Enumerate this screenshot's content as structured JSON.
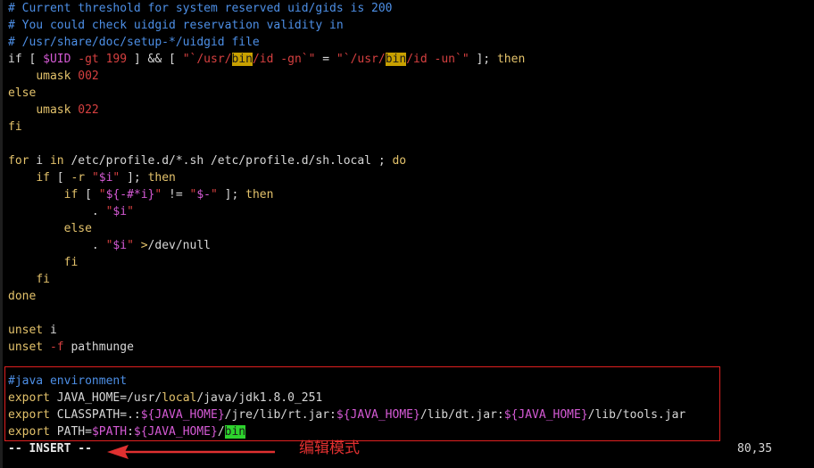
{
  "editor": {
    "lines": [
      [
        {
          "t": "# Current threshold for system reserved uid/gids is 200",
          "c": "cmt"
        }
      ],
      [
        {
          "t": "# You could check uidgid reservation validity in",
          "c": "cmt"
        }
      ],
      [
        {
          "t": "# /usr/share/doc/setup-*/uidgid file",
          "c": "cmt"
        }
      ],
      [
        {
          "t": "if",
          "c": "kw"
        },
        {
          "t": " [ "
        },
        {
          "t": "$UID",
          "c": "var"
        },
        {
          "t": " -gt ",
          "c": "str"
        },
        {
          "t": "199",
          "c": "str"
        },
        {
          "t": " ] && [ "
        },
        {
          "t": "\"`/usr/",
          "c": "str"
        },
        {
          "t": "bin",
          "c": "hl"
        },
        {
          "t": "/id -gn`\"",
          "c": "str"
        },
        {
          "t": " = "
        },
        {
          "t": "\"`/usr/",
          "c": "str"
        },
        {
          "t": "bin",
          "c": "hl"
        },
        {
          "t": "/id -un`\"",
          "c": "str"
        },
        {
          "t": " ]; "
        },
        {
          "t": "then",
          "c": "stmt"
        }
      ],
      [
        {
          "t": "    "
        },
        {
          "t": "umask",
          "c": "stmt"
        },
        {
          "t": " "
        },
        {
          "t": "002",
          "c": "str"
        }
      ],
      [
        {
          "t": "else",
          "c": "stmt"
        }
      ],
      [
        {
          "t": "    "
        },
        {
          "t": "umask",
          "c": "stmt"
        },
        {
          "t": " "
        },
        {
          "t": "022",
          "c": "str"
        }
      ],
      [
        {
          "t": "fi",
          "c": "stmt"
        }
      ],
      [
        {
          "t": ""
        }
      ],
      [
        {
          "t": "for",
          "c": "stmt"
        },
        {
          "t": " i "
        },
        {
          "t": "in",
          "c": "stmt"
        },
        {
          "t": " /etc/profile.d/*.sh /etc/profile.d/sh.local ; "
        },
        {
          "t": "do",
          "c": "stmt"
        }
      ],
      [
        {
          "t": "    "
        },
        {
          "t": "if",
          "c": "stmt"
        },
        {
          "t": " [ "
        },
        {
          "t": "-r",
          "c": "stmt"
        },
        {
          "t": " "
        },
        {
          "t": "\"",
          "c": "str"
        },
        {
          "t": "$i",
          "c": "var"
        },
        {
          "t": "\"",
          "c": "str"
        },
        {
          "t": " ]; "
        },
        {
          "t": "then",
          "c": "stmt"
        }
      ],
      [
        {
          "t": "        "
        },
        {
          "t": "if",
          "c": "stmt"
        },
        {
          "t": " [ "
        },
        {
          "t": "\"",
          "c": "str"
        },
        {
          "t": "${-#*i}",
          "c": "var"
        },
        {
          "t": "\"",
          "c": "str"
        },
        {
          "t": " != "
        },
        {
          "t": "\"",
          "c": "str"
        },
        {
          "t": "$-",
          "c": "var"
        },
        {
          "t": "\"",
          "c": "str"
        },
        {
          "t": " ]; "
        },
        {
          "t": "then",
          "c": "stmt"
        }
      ],
      [
        {
          "t": "            . "
        },
        {
          "t": "\"",
          "c": "str"
        },
        {
          "t": "$i",
          "c": "var"
        },
        {
          "t": "\"",
          "c": "str"
        }
      ],
      [
        {
          "t": "        "
        },
        {
          "t": "else",
          "c": "stmt"
        }
      ],
      [
        {
          "t": "            . "
        },
        {
          "t": "\"",
          "c": "str"
        },
        {
          "t": "$i",
          "c": "var"
        },
        {
          "t": "\"",
          "c": "str"
        },
        {
          "t": " "
        },
        {
          "t": ">",
          "c": "stmt"
        },
        {
          "t": "/dev/null"
        }
      ],
      [
        {
          "t": "        "
        },
        {
          "t": "fi",
          "c": "stmt"
        }
      ],
      [
        {
          "t": "    "
        },
        {
          "t": "fi",
          "c": "stmt"
        }
      ],
      [
        {
          "t": "done",
          "c": "stmt"
        }
      ],
      [
        {
          "t": ""
        }
      ],
      [
        {
          "t": "unset",
          "c": "stmt"
        },
        {
          "t": " "
        },
        {
          "t": "i",
          "c": "kw"
        }
      ],
      [
        {
          "t": "unset",
          "c": "stmt"
        },
        {
          "t": " "
        },
        {
          "t": "-f",
          "c": "str"
        },
        {
          "t": " "
        },
        {
          "t": "pathmunge",
          "c": "kw"
        }
      ],
      [
        {
          "t": ""
        }
      ],
      [
        {
          "t": "#java environment",
          "c": "cmt"
        }
      ],
      [
        {
          "t": "export",
          "c": "stmt"
        },
        {
          "t": " "
        },
        {
          "t": "JAVA_HOME",
          "c": "kw"
        },
        {
          "t": "=/usr/"
        },
        {
          "t": "local",
          "c": "stmt"
        },
        {
          "t": "/java/jdk1.8.0_251"
        }
      ],
      [
        {
          "t": "export",
          "c": "stmt"
        },
        {
          "t": " "
        },
        {
          "t": "CLASSPATH",
          "c": "kw"
        },
        {
          "t": "=.:"
        },
        {
          "t": "${JAVA_HOME}",
          "c": "var"
        },
        {
          "t": "/jre/lib/rt.jar:"
        },
        {
          "t": "${JAVA_HOME}",
          "c": "var"
        },
        {
          "t": "/lib/dt.jar:"
        },
        {
          "t": "${JAVA_HOME}",
          "c": "var"
        },
        {
          "t": "/lib/tools.jar"
        }
      ],
      [
        {
          "t": "export",
          "c": "stmt"
        },
        {
          "t": " "
        },
        {
          "t": "PATH",
          "c": "kw"
        },
        {
          "t": "="
        },
        {
          "t": "$PATH",
          "c": "var"
        },
        {
          "t": ":"
        },
        {
          "t": "${JAVA_HOME}",
          "c": "var"
        },
        {
          "t": "/"
        },
        {
          "t": "bin",
          "c": "cur"
        }
      ]
    ]
  },
  "status": {
    "mode": "-- INSERT --",
    "position": "80,35"
  },
  "annotation": {
    "text": "编辑模式",
    "color": "#e03030"
  },
  "colors": {
    "background": "#000000",
    "comment": "#4d8fe6",
    "statement": "#e3c26b",
    "variable": "#d55ad5",
    "string": "#d64040",
    "search_highlight": "#c8a000",
    "cursor": "#2dd32d",
    "annotation_box": "#e02020"
  }
}
